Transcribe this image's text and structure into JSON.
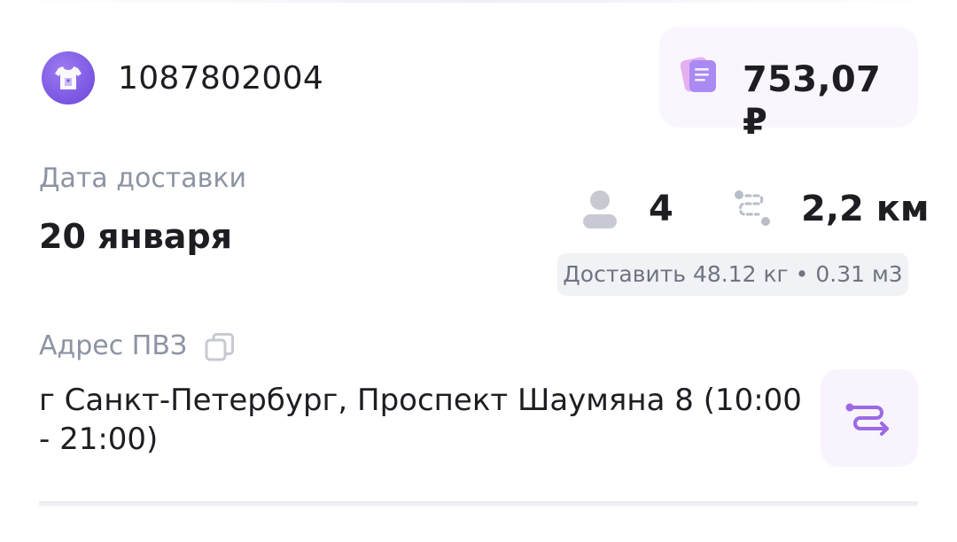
{
  "header": {
    "order_id": "1087802004",
    "shop_icon": "tshirt-icon",
    "price": "753,07 ₽",
    "price_icon": "receipt-icon"
  },
  "delivery": {
    "date_label": "Дата доставки",
    "date_value": "20 января",
    "person_icon": "person-icon",
    "item_count": "4",
    "route_icon": "route-distance-icon",
    "distance": "2,2 км",
    "weight_volume": "Доставить 48.12 кг • 0.31 м3"
  },
  "address": {
    "label": "Адрес ПВЗ",
    "copy_icon": "copy-icon",
    "value": "г Санкт-Петербург, Проспект Шаумяна 8 (10:00 - 21:00)",
    "route_button_icon": "route-icon"
  },
  "colors": {
    "accent": "#7a55e3",
    "muted_text": "#8c93a3",
    "chip_bg": "#faf6fe",
    "gray_chip_bg": "#f1f2f5"
  }
}
